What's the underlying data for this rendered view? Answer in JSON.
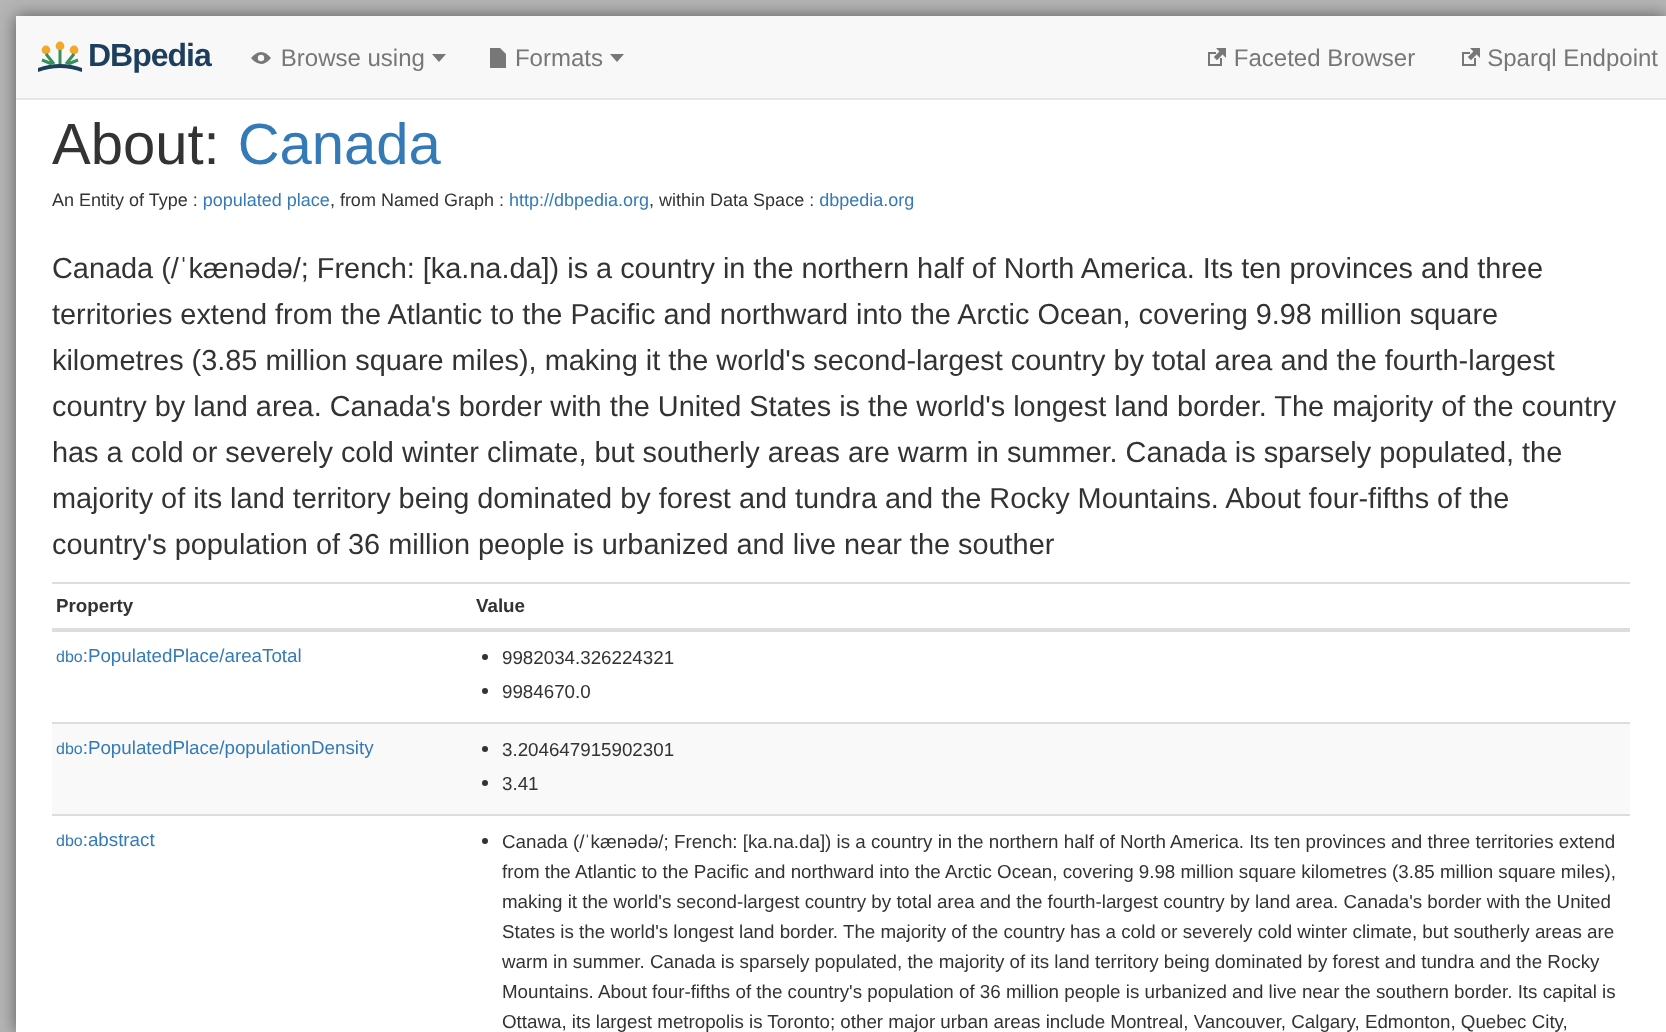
{
  "navbar": {
    "brand": "DBpedia",
    "menus": [
      {
        "kind": "eye",
        "label": "Browse using"
      },
      {
        "kind": "file",
        "label": "Formats"
      }
    ],
    "links": [
      "Faceted Browser",
      "Sparql Endpoint"
    ]
  },
  "heading": {
    "prefix": "About:",
    "entity": "Canada"
  },
  "subtitle": {
    "parts": [
      {
        "kind": "text",
        "text": "An Entity of Type : "
      },
      {
        "kind": "link",
        "text": "populated place"
      },
      {
        "kind": "text",
        "text": ", from Named Graph : "
      },
      {
        "kind": "link",
        "text": "http://dbpedia.org"
      },
      {
        "kind": "text",
        "text": ", within Data Space : "
      },
      {
        "kind": "link",
        "text": "dbpedia.org"
      }
    ]
  },
  "summary": "Canada (/ˈkænədə/; French: [ka.na.da]) is a country in the northern half of North America. Its ten provinces and three territories extend from the Atlantic to the Pacific and northward into the Arctic Ocean, covering 9.98 million square kilometres (3.85 million square miles), making it the world's second-largest country by total area and the fourth-largest country by land area. Canada's border with the United States is the world's longest land border. The majority of the country has a cold or severely cold winter climate, but southerly areas are warm in summer. Canada is sparsely populated, the majority of its land territory being dominated by forest and tundra and the Rocky Mountains. About four-fifths of the country's population of 36 million people is urbanized and live near the souther",
  "table": {
    "columns": [
      "Property",
      "Value"
    ],
    "rows": [
      {
        "prefix": "dbo",
        "property": ":PopulatedPlace/areaTotal",
        "values": [
          "9982034.326224321",
          "9984670.0"
        ]
      },
      {
        "prefix": "dbo",
        "property": ":PopulatedPlace/populationDensity",
        "values": [
          "3.204647915902301",
          "3.41"
        ]
      },
      {
        "prefix": "dbo",
        "property": ":abstract",
        "values": [
          "Canada (/ˈkænədə/; French: [ka.na.da]) is a country in the northern half of North America. Its ten provinces and three territories extend from the Atlantic to the Pacific and northward into the Arctic Ocean, covering 9.98 million square kilometres (3.85 million square miles), making it the world's second-largest country by total area and the fourth-largest country by land area. Canada's border with the United States is the world's longest land border. The majority of the country has a cold or severely cold winter climate, but southerly areas are warm in summer. Canada is sparsely populated, the majority of its land territory being dominated by forest and tundra and the Rocky Mountains. About four-fifths of the country's population of 36 million people is urbanized and live near the southern border. Its capital is Ottawa, its largest metropolis is Toronto; other major urban areas include Montreal, Vancouver, Calgary, Edmonton, Quebec City,"
        ]
      }
    ]
  }
}
